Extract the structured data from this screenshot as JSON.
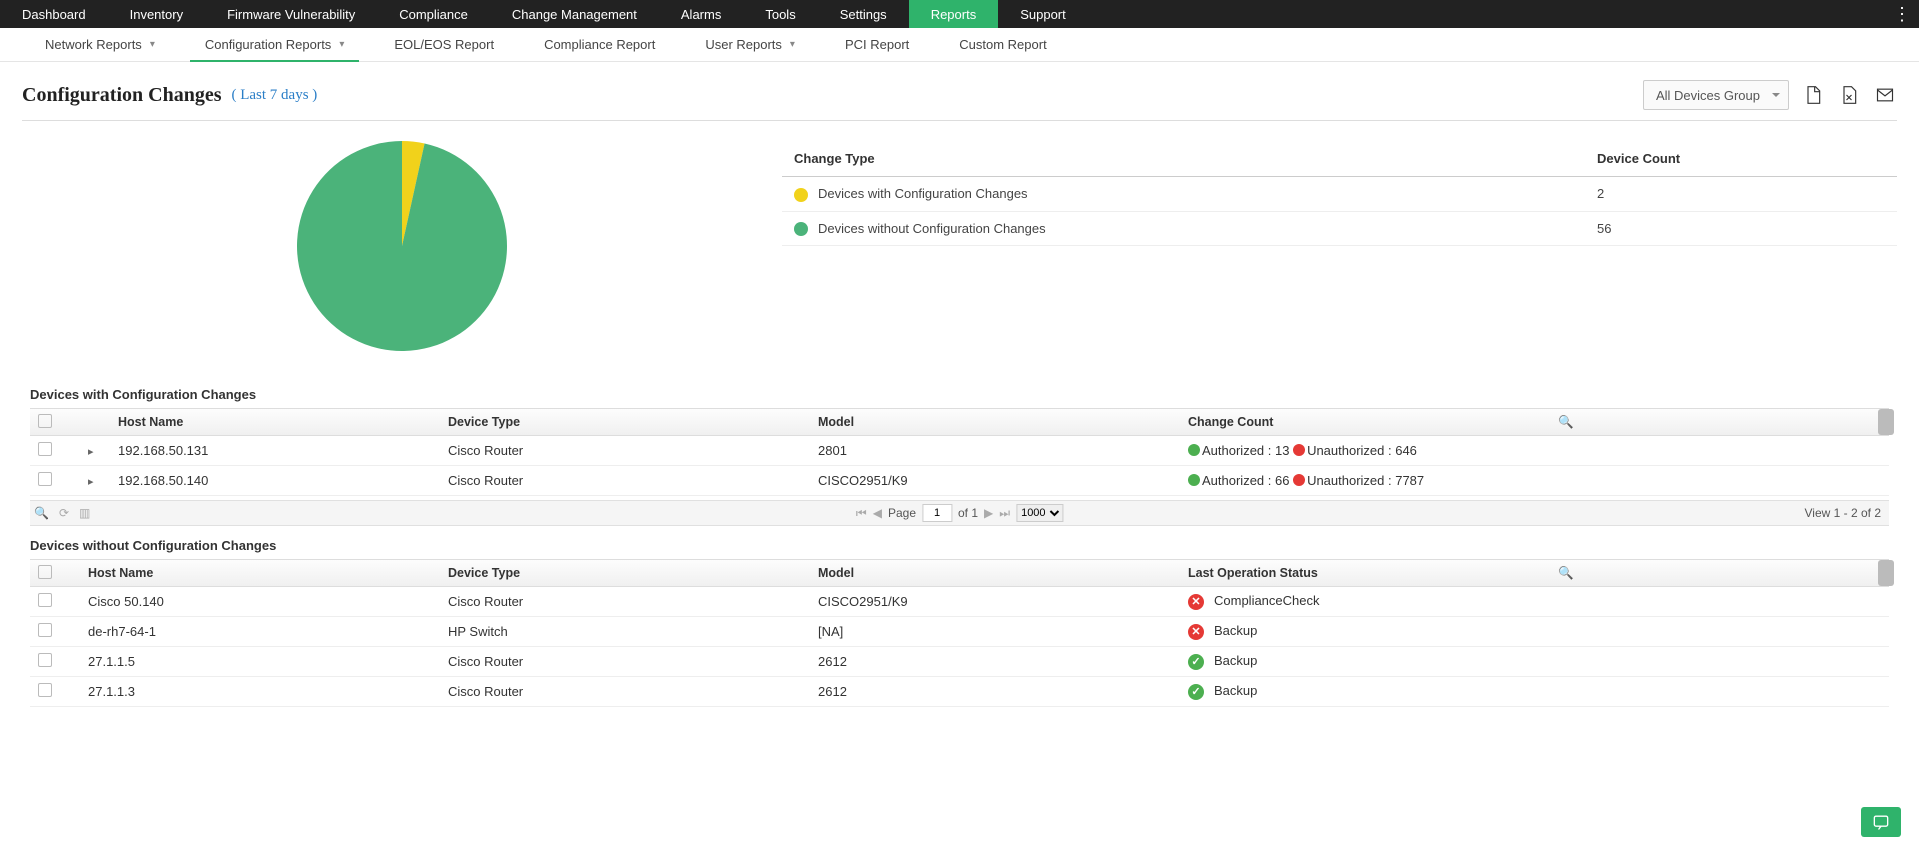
{
  "topnav": [
    "Dashboard",
    "Inventory",
    "Firmware Vulnerability",
    "Compliance",
    "Change Management",
    "Alarms",
    "Tools",
    "Settings",
    "Reports",
    "Support"
  ],
  "topnav_active": 8,
  "subnav": [
    {
      "label": "Network Reports",
      "caret": true
    },
    {
      "label": "Configuration Reports",
      "caret": true
    },
    {
      "label": "EOL/EOS Report",
      "caret": false
    },
    {
      "label": "Compliance Report",
      "caret": false
    },
    {
      "label": "User Reports",
      "caret": true
    },
    {
      "label": "PCI Report",
      "caret": false
    },
    {
      "label": "Custom Report",
      "caret": false
    }
  ],
  "subnav_active": 1,
  "page": {
    "title": "Configuration Changes",
    "range": "( Last 7 days )",
    "group": "All Devices Group"
  },
  "chart_data": {
    "type": "pie",
    "title": "",
    "series": [
      {
        "name": "Devices with Configuration Changes",
        "value": 2,
        "color": "#f1d21b"
      },
      {
        "name": "Devices without Configuration Changes",
        "value": 56,
        "color": "#4bb37a"
      }
    ]
  },
  "legend": {
    "headers": [
      "Change Type",
      "Device Count"
    ],
    "rows": [
      {
        "color": "yellow",
        "label": "Devices with Configuration Changes",
        "count": "2"
      },
      {
        "color": "green",
        "label": "Devices without Configuration Changes",
        "count": "56"
      }
    ]
  },
  "section1": {
    "title": "Devices with Configuration Changes",
    "headers": [
      "Host Name",
      "Device Type",
      "Model",
      "Change Count"
    ],
    "rows": [
      {
        "host": "192.168.50.131",
        "type": "Cisco Router",
        "model": "2801",
        "auth": "Authorized : 13",
        "unauth": "Unauthorized : 646"
      },
      {
        "host": "192.168.50.140",
        "type": "Cisco Router",
        "model": "CISCO2951/K9",
        "auth": "Authorized : 66",
        "unauth": "Unauthorized : 7787"
      }
    ]
  },
  "pager": {
    "page_label": "Page",
    "page_val": "1",
    "of": "of 1",
    "size": "1000",
    "view": "View 1 - 2 of 2"
  },
  "section2": {
    "title": "Devices without Configuration Changes",
    "headers": [
      "Host Name",
      "Device Type",
      "Model",
      "Last Operation Status"
    ],
    "rows": [
      {
        "host": "Cisco 50.140",
        "type": "Cisco Router",
        "model": "CISCO2951/K9",
        "status": "ComplianceCheck",
        "ok": false
      },
      {
        "host": "de-rh7-64-1",
        "type": "HP Switch",
        "model": "[NA]",
        "status": "Backup",
        "ok": false
      },
      {
        "host": "27.1.1.5",
        "type": "Cisco Router",
        "model": "2612",
        "status": "Backup",
        "ok": true
      },
      {
        "host": "27.1.1.3",
        "type": "Cisco Router",
        "model": "2612",
        "status": "Backup",
        "ok": true
      }
    ]
  }
}
